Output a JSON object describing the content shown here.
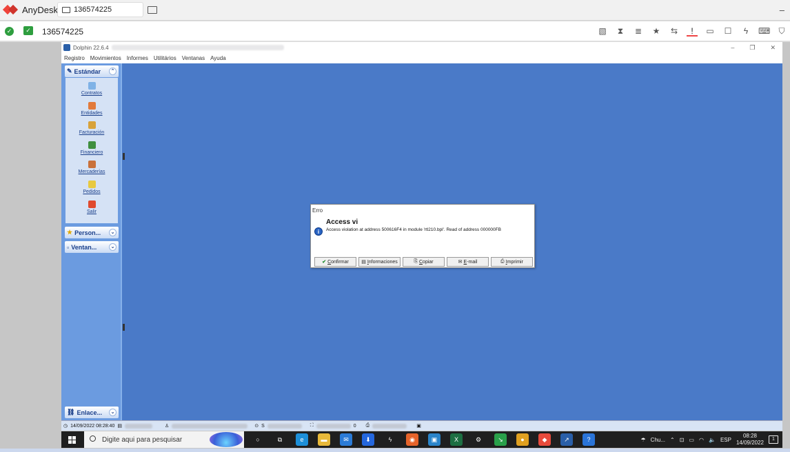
{
  "anydesk": {
    "app_name": "AnyDesk",
    "tab_label": "136574225",
    "address": "136574225",
    "minimize": "–",
    "colors": {
      "brand": "#ef443b",
      "ok": "#2e9e3f"
    }
  },
  "dolphin": {
    "title": "Dolphin 22.6.4",
    "window_controls": {
      "minimize": "–",
      "restore": "❐",
      "close": "✕"
    },
    "menu": [
      "Registro",
      "Movimientos",
      "Informes",
      "Utilitários",
      "Ventanas",
      "Ayuda"
    ],
    "sidebar": {
      "group_standard": "Estándar",
      "items": [
        {
          "label": "Contratos",
          "icon": "contracts-icon",
          "color": "#7fb2e6"
        },
        {
          "label": "Entidades",
          "icon": "entities-icon",
          "color": "#e27a3b"
        },
        {
          "label": "Facturación",
          "icon": "billing-icon",
          "color": "#d8a23a"
        },
        {
          "label": "Financiero",
          "icon": "finance-icon",
          "color": "#3f8f3f"
        },
        {
          "label": "Mercaderías",
          "icon": "goods-icon",
          "color": "#c9713a"
        },
        {
          "label": "Pedidos",
          "icon": "orders-icon",
          "color": "#e8c940"
        },
        {
          "label": "Salir",
          "icon": "exit-icon",
          "color": "#e04a2e"
        }
      ],
      "group_personal": "Person...",
      "group_ventanas": "Ventan...",
      "group_enlaces": "Enlace..."
    },
    "statusbar": {
      "datetime": "14/09/2022 08:28:40",
      "s_text": "S",
      "zero_text": "0"
    },
    "background_color": "#4a7ac8"
  },
  "dialog": {
    "title": "Erro",
    "heading": "Access vi",
    "message": "Access violation at address 500616F4 in module 'rtl210.bpl'. Read of address 000000FB",
    "buttons": [
      {
        "id": "confirmar",
        "mn": "C",
        "rest": "onfirmar",
        "icon": "✔",
        "icon_name": "check-icon",
        "width": 61
      },
      {
        "id": "informaciones",
        "mn": "I",
        "rest": "nformaciones",
        "icon": "▤",
        "icon_name": "info-list-icon",
        "width": 61
      },
      {
        "id": "copiar",
        "mn": "C",
        "rest": "opiar",
        "icon": "⎘",
        "icon_name": "copy-icon",
        "width": 61
      },
      {
        "id": "email",
        "mn": "E",
        "rest": "-mail",
        "icon": "✉",
        "icon_name": "mail-icon",
        "width": 61
      },
      {
        "id": "imprimir",
        "mn": "I",
        "rest": "mprimir",
        "icon": "⎙",
        "icon_name": "print-icon",
        "width": 61
      }
    ]
  },
  "taskbar": {
    "search_placeholder": "Digite aqui para pesquisar",
    "apps": [
      {
        "glyph": "○",
        "name": "cortana-icon",
        "bg": "transparent"
      },
      {
        "glyph": "⧉",
        "name": "task-view-icon",
        "bg": "transparent"
      },
      {
        "glyph": "e",
        "name": "edge-icon",
        "bg": "#1d8fd8"
      },
      {
        "glyph": "▬",
        "name": "file-explorer-icon",
        "bg": "#e8b93a"
      },
      {
        "glyph": "✉",
        "name": "mail-icon",
        "bg": "#2b7bd6"
      },
      {
        "glyph": "⬇",
        "name": "dropbox-icon",
        "bg": "#2567dd"
      },
      {
        "glyph": "ϟ",
        "name": "winbox-icon",
        "bg": "transparent"
      },
      {
        "glyph": "◉",
        "name": "firefox-icon",
        "bg": "#e5632a"
      },
      {
        "glyph": "▣",
        "name": "photos-icon",
        "bg": "#2a84c9"
      },
      {
        "glyph": "X",
        "name": "excel-icon",
        "bg": "#1d6f42"
      },
      {
        "glyph": "⚙",
        "name": "settings-icon",
        "bg": "transparent"
      },
      {
        "glyph": "↘",
        "name": "app-green-icon",
        "bg": "#2aa04a"
      },
      {
        "glyph": "●",
        "name": "chrome-icon",
        "bg": "#e0a020"
      },
      {
        "glyph": "◆",
        "name": "anydesk-taskbar-icon",
        "bg": "#e84b3c"
      },
      {
        "glyph": "↗",
        "name": "dolphin-taskbar-icon",
        "bg": "#2a5fa8"
      },
      {
        "glyph": "?",
        "name": "help-icon",
        "bg": "#2a74d8"
      }
    ],
    "weather": "Chu...",
    "language": "ESP",
    "time": "08:28",
    "date": "14/09/2022",
    "notifications": "1"
  }
}
